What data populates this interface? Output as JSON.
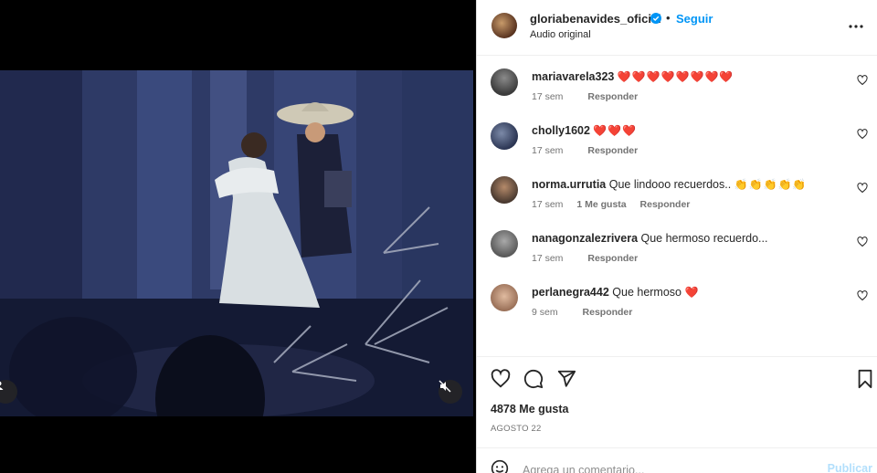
{
  "post": {
    "username": "gloriabenavides_oficial",
    "verified": true,
    "separator": "•",
    "follow_label": "Seguir",
    "audio_label": "Audio original",
    "likes_text": "4878 Me gusta",
    "date_text": "AGOSTO 22"
  },
  "comments": [
    {
      "user": "mariavarela323",
      "text": "",
      "emojis": "❤️❤️❤️❤️❤️❤️❤️❤️",
      "time": "17 sem",
      "likes": "",
      "reply": "Responder"
    },
    {
      "user": "cholly1602",
      "text": "",
      "emojis": "❤️❤️❤️",
      "time": "17 sem",
      "likes": "",
      "reply": "Responder"
    },
    {
      "user": "norma.urrutia",
      "text": "Que lindooo recuerdos..",
      "emojis": "👏👏👏👏👏",
      "time": "17 sem",
      "likes": "1 Me gusta",
      "reply": "Responder"
    },
    {
      "user": "nanagonzalezrivera",
      "text": "Que hermoso recuerdo...",
      "emojis": "",
      "time": "17 sem",
      "likes": "",
      "reply": "Responder"
    },
    {
      "user": "perlanegra442",
      "text": "Que hermoso",
      "emojis": "❤️",
      "time": "9 sem",
      "likes": "",
      "reply": "Responder"
    }
  ],
  "composer": {
    "placeholder": "Agrega un comentario...",
    "publish_label": "Publicar"
  },
  "icons": {
    "like": "heart-icon",
    "comment": "comment-icon",
    "share": "share-icon",
    "save": "bookmark-icon",
    "more": "more-icon",
    "mute": "muted-speaker-icon",
    "emoji": "emoji-icon",
    "load_more": "plus-circle-icon"
  },
  "colors": {
    "link_blue": "#0095f6",
    "publish_disabled": "#b2dffc",
    "meta_gray": "#737373",
    "heart_red": "#ed4956"
  }
}
